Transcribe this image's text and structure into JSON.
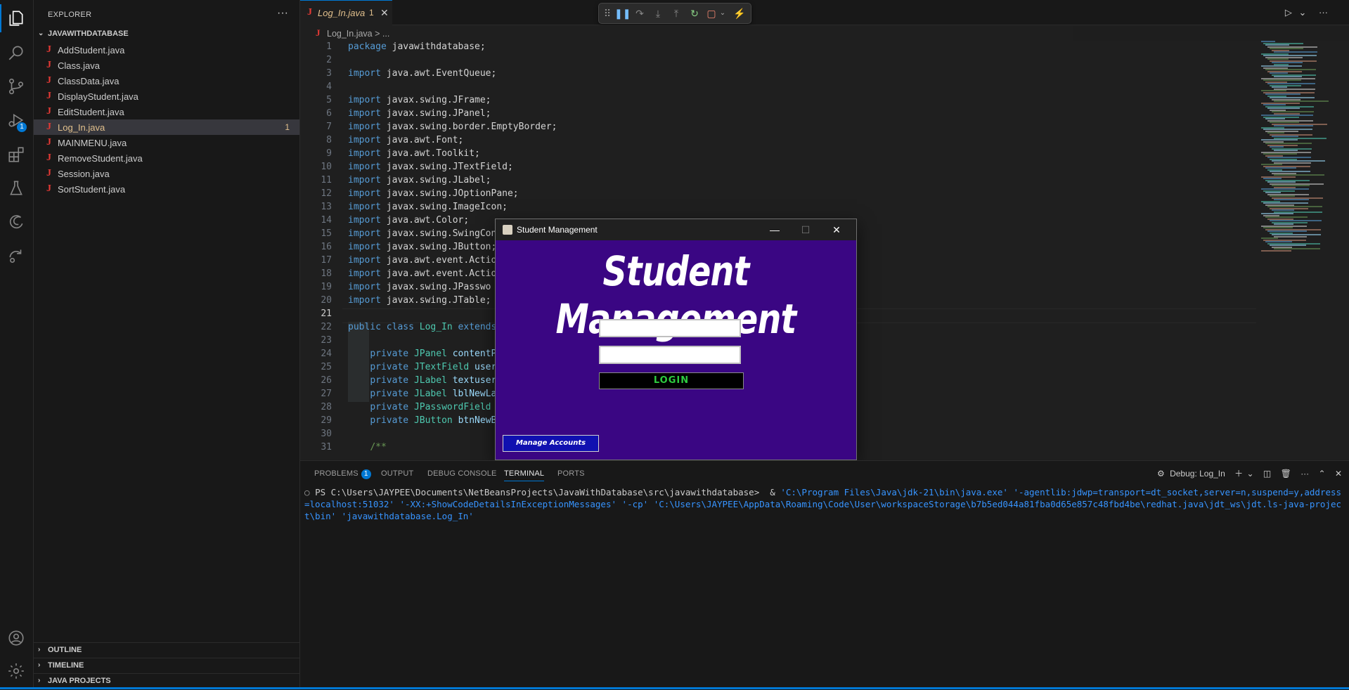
{
  "sidebar": {
    "title": "EXPLORER",
    "project": "JAVAWITHDATABASE",
    "files": [
      {
        "name": "AddStudent.java",
        "count": ""
      },
      {
        "name": "Class.java",
        "count": ""
      },
      {
        "name": "ClassData.java",
        "count": ""
      },
      {
        "name": "DisplayStudent.java",
        "count": ""
      },
      {
        "name": "EditStudent.java",
        "count": ""
      },
      {
        "name": "Log_In.java",
        "count": "1"
      },
      {
        "name": "MAINMENU.java",
        "count": ""
      },
      {
        "name": "RemoveStudent.java",
        "count": ""
      },
      {
        "name": "Session.java",
        "count": ""
      },
      {
        "name": "SortStudent.java",
        "count": ""
      }
    ],
    "sections": [
      "OUTLINE",
      "TIMELINE",
      "JAVA PROJECTS"
    ],
    "more_label": "···"
  },
  "activity": {
    "debug_badge": "1"
  },
  "tab": {
    "name": "Log_In.java",
    "problems": "1",
    "close": "✕"
  },
  "breadcrumb": {
    "file": "Log_In.java",
    "rest": "> ..."
  },
  "editor": {
    "current_line": 21,
    "lines": [
      {
        "n": "1",
        "t": [
          [
            "kw",
            "package "
          ],
          [
            "plain",
            "javawithdatabase;"
          ]
        ]
      },
      {
        "n": "2",
        "t": []
      },
      {
        "n": "3",
        "t": [
          [
            "kw",
            "import "
          ],
          [
            "plain",
            "java.awt.EventQueue;"
          ]
        ]
      },
      {
        "n": "4",
        "t": []
      },
      {
        "n": "5",
        "t": [
          [
            "kw",
            "import "
          ],
          [
            "plain",
            "javax.swing.JFrame;"
          ]
        ]
      },
      {
        "n": "6",
        "t": [
          [
            "kw",
            "import "
          ],
          [
            "plain",
            "javax.swing.JPanel;"
          ]
        ]
      },
      {
        "n": "7",
        "t": [
          [
            "kw",
            "import "
          ],
          [
            "plain",
            "javax.swing.border.EmptyBorder;"
          ]
        ]
      },
      {
        "n": "8",
        "t": [
          [
            "kw",
            "import "
          ],
          [
            "plain",
            "java.awt.Font;"
          ]
        ]
      },
      {
        "n": "9",
        "t": [
          [
            "kw",
            "import "
          ],
          [
            "plain",
            "java.awt.Toolkit;"
          ]
        ]
      },
      {
        "n": "10",
        "t": [
          [
            "kw",
            "import "
          ],
          [
            "plain",
            "javax.swing.JTextField;"
          ]
        ]
      },
      {
        "n": "11",
        "t": [
          [
            "kw",
            "import "
          ],
          [
            "plain",
            "javax.swing.JLabel;"
          ]
        ]
      },
      {
        "n": "12",
        "t": [
          [
            "kw",
            "import "
          ],
          [
            "plain",
            "javax.swing.JOptionPane;"
          ]
        ]
      },
      {
        "n": "13",
        "t": [
          [
            "kw",
            "import "
          ],
          [
            "plain",
            "javax.swing.ImageIcon;"
          ]
        ]
      },
      {
        "n": "14",
        "t": [
          [
            "kw",
            "import "
          ],
          [
            "plain",
            "java.awt.Color;"
          ]
        ]
      },
      {
        "n": "15",
        "t": [
          [
            "kw",
            "import "
          ],
          [
            "plain",
            "javax.swing.SwingCon"
          ]
        ]
      },
      {
        "n": "16",
        "t": [
          [
            "kw",
            "import "
          ],
          [
            "plain",
            "javax.swing.JButton;"
          ]
        ]
      },
      {
        "n": "17",
        "t": [
          [
            "kw",
            "import "
          ],
          [
            "plain",
            "java.awt.event.Actio"
          ]
        ]
      },
      {
        "n": "18",
        "t": [
          [
            "kw",
            "import "
          ],
          [
            "plain",
            "java.awt.event.Actio"
          ]
        ]
      },
      {
        "n": "19",
        "t": [
          [
            "kw",
            "import "
          ],
          [
            "plain",
            "javax.swing.JPasswo"
          ]
        ]
      },
      {
        "n": "20",
        "t": [
          [
            "kw",
            "import "
          ],
          [
            "plain",
            "javax.swing.JTable;"
          ]
        ]
      },
      {
        "n": "21",
        "t": []
      },
      {
        "n": "22",
        "t": [
          [
            "kw",
            "public class "
          ],
          [
            "typ",
            "Log_In "
          ],
          [
            "kw",
            "extends"
          ]
        ]
      },
      {
        "n": "23",
        "t": []
      },
      {
        "n": "24",
        "t": [
          [
            "plain",
            "    "
          ],
          [
            "kw",
            "private "
          ],
          [
            "typ",
            "JPanel "
          ],
          [
            "var",
            "contentP"
          ]
        ]
      },
      {
        "n": "25",
        "t": [
          [
            "plain",
            "    "
          ],
          [
            "kw",
            "private "
          ],
          [
            "typ",
            "JTextField "
          ],
          [
            "var",
            "user"
          ]
        ]
      },
      {
        "n": "26",
        "t": [
          [
            "plain",
            "    "
          ],
          [
            "kw",
            "private "
          ],
          [
            "typ",
            "JLabel "
          ],
          [
            "var",
            "textuser"
          ]
        ]
      },
      {
        "n": "27",
        "t": [
          [
            "plain",
            "    "
          ],
          [
            "kw",
            "private "
          ],
          [
            "typ",
            "JLabel "
          ],
          [
            "var",
            "lblNewLa"
          ]
        ]
      },
      {
        "n": "28",
        "t": [
          [
            "plain",
            "    "
          ],
          [
            "kw",
            "private "
          ],
          [
            "typ",
            "JPasswordField "
          ]
        ]
      },
      {
        "n": "29",
        "t": [
          [
            "plain",
            "    "
          ],
          [
            "kw",
            "private "
          ],
          [
            "typ",
            "JButton "
          ],
          [
            "var",
            "btnNewB"
          ]
        ]
      },
      {
        "n": "30",
        "t": []
      },
      {
        "n": "31",
        "t": [
          [
            "plain",
            "    "
          ],
          [
            "cmt",
            "/**"
          ]
        ]
      }
    ]
  },
  "dialog": {
    "title": "Student Management",
    "heading": "Student Management",
    "username_value": "",
    "password_value": "",
    "login_label": "LOGIN",
    "manage_label": "Manage Accounts"
  },
  "panel": {
    "tabs": [
      "PROBLEMS",
      "OUTPUT",
      "DEBUG CONSOLE",
      "TERMINAL",
      "PORTS"
    ],
    "problems_count": "1",
    "active_tab": "TERMINAL",
    "debug_session": "Debug: Log_In",
    "terminal_prompt": "PS C:\\Users\\JAYPEE\\Documents\\NetBeansProjects\\JavaWithDatabase\\src\\javawithdatabase>  & ",
    "terminal_cmd": "'C:\\Program Files\\Java\\jdk-21\\bin\\java.exe' '-agentlib:jdwp=transport=dt_socket,server=n,suspend=y,address=localhost:51032' '-XX:+ShowCodeDetailsInExceptionMessages' '-cp' 'C:\\Users\\JAYPEE\\AppData\\Roaming\\Code\\User\\workspaceStorage\\b7b5ed044a81fba0d65e857c48fbd4be\\redhat.java\\jdt_ws\\jdt.ls-java-project\\bin' 'javawithdatabase.Log_In'"
  },
  "colors": {
    "accent": "#0078d4",
    "dialog_bg": "#3a0683",
    "login_text": "#2ecc40",
    "manage_bg": "#1010b0"
  }
}
